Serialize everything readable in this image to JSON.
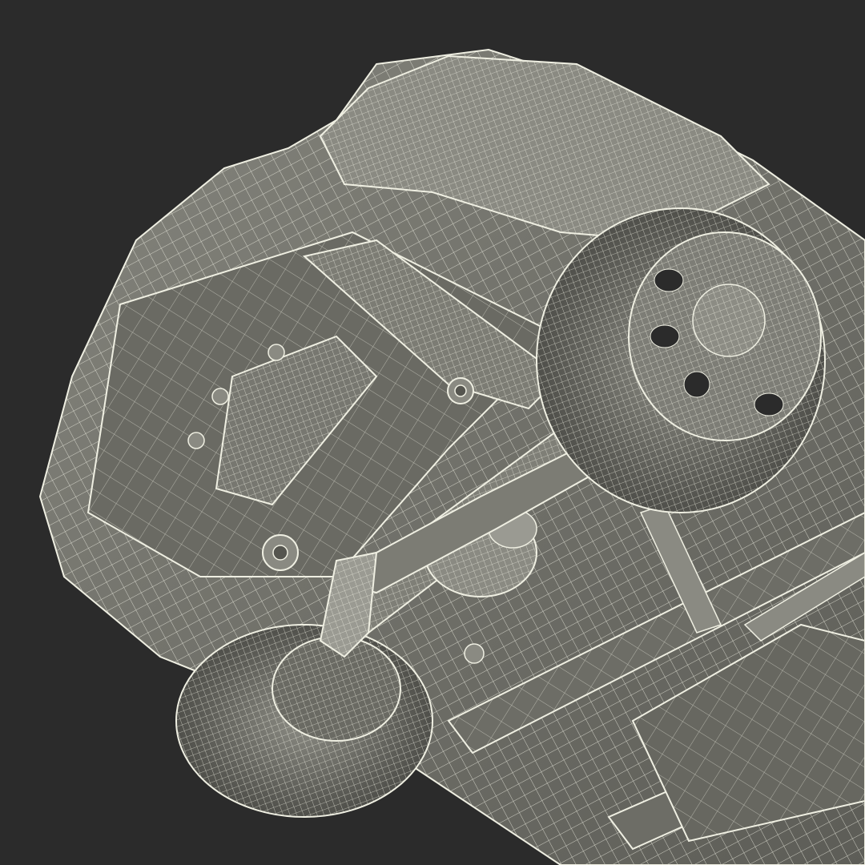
{
  "image": {
    "subject": "car-undercarriage-wireframe-render",
    "colors": {
      "background": "#2b2b2b",
      "surface": "#6f6f68",
      "surface_light": "#8c8c84",
      "surface_dark": "#55554f",
      "wire": "#efefe2",
      "shadow": "#3a3a36"
    }
  }
}
